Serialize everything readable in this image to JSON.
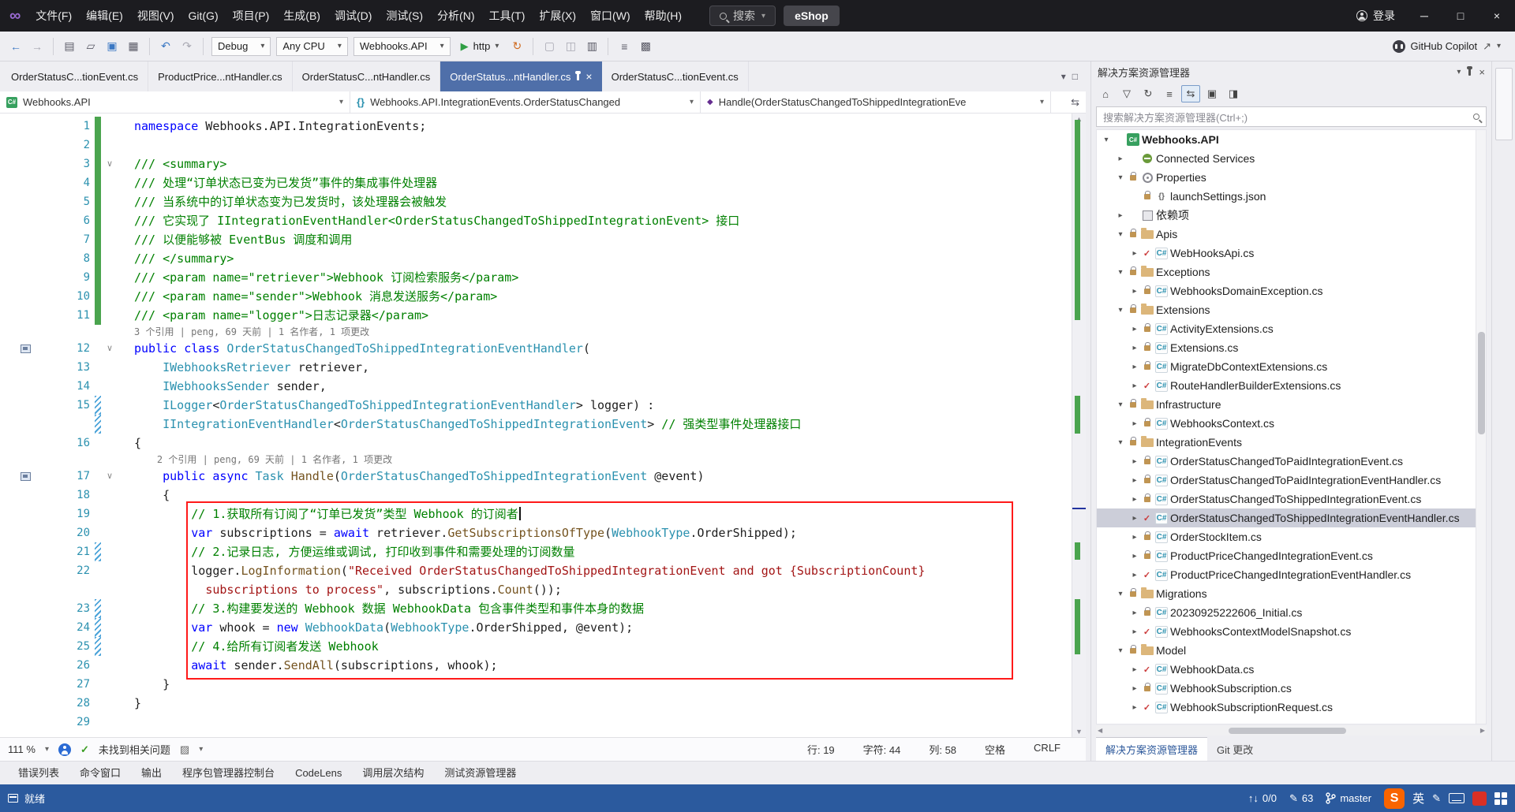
{
  "window": {
    "signin": "登录"
  },
  "menu": {
    "items": [
      "文件(F)",
      "编辑(E)",
      "视图(V)",
      "Git(G)",
      "项目(P)",
      "生成(B)",
      "调试(D)",
      "测试(S)",
      "分析(N)",
      "工具(T)",
      "扩展(X)",
      "窗口(W)",
      "帮助(H)"
    ],
    "search_label": "搜索",
    "project_pill": "eShop"
  },
  "toolbar": {
    "debug": "Debug",
    "platform": "Any CPU",
    "project": "Webhooks.API",
    "profile": "http",
    "copilot": "GitHub Copilot"
  },
  "tabs": [
    {
      "label": "OrderStatusC...tionEvent.cs",
      "active": false
    },
    {
      "label": "ProductPrice...ntHandler.cs",
      "active": false
    },
    {
      "label": "OrderStatusC...ntHandler.cs",
      "active": false
    },
    {
      "label": "OrderStatus...ntHandler.cs",
      "active": true
    },
    {
      "label": "OrderStatusC...tionEvent.cs",
      "active": false
    }
  ],
  "navbar": {
    "project": "Webhooks.API",
    "type": "Webhooks.API.IntegrationEvents.OrderStatusChanged",
    "member": "Handle(OrderStatusChangedToShippedIntegrationEve"
  },
  "editor": {
    "rows": [
      {
        "n": "1",
        "b": "g",
        "s": [
          [
            "namespace",
            "k"
          ],
          [
            " Webhooks.API.IntegrationEvents;",
            "p"
          ]
        ]
      },
      {
        "n": "2",
        "b": "g",
        "s": []
      },
      {
        "n": "3",
        "b": "g",
        "f": 1,
        "s": [
          [
            "/// <summary>",
            "c"
          ]
        ]
      },
      {
        "n": "4",
        "b": "g",
        "s": [
          [
            "/// 处理“订单状态已变为已发货”事件的集成事件处理器",
            "c"
          ]
        ]
      },
      {
        "n": "5",
        "b": "g",
        "s": [
          [
            "/// 当系统中的订单状态变为已发货时，该处理器会被触发",
            "c"
          ]
        ]
      },
      {
        "n": "6",
        "b": "g",
        "s": [
          [
            "/// 它实现了 IIntegrationEventHandler<OrderStatusChangedToShippedIntegrationEvent> 接口",
            "c"
          ]
        ]
      },
      {
        "n": "7",
        "b": "g",
        "s": [
          [
            "/// 以便能够被 EventBus 调度和调用",
            "c"
          ]
        ]
      },
      {
        "n": "8",
        "b": "g",
        "s": [
          [
            "/// </summary>",
            "c"
          ]
        ]
      },
      {
        "n": "9",
        "b": "g",
        "s": [
          [
            "/// <param name=\"retriever\">Webhook 订阅检索服务</param>",
            "c"
          ]
        ]
      },
      {
        "n": "10",
        "b": "g",
        "s": [
          [
            "/// <param name=\"sender\">Webhook 消息发送服务</param>",
            "c"
          ]
        ]
      },
      {
        "n": "11",
        "b": "g",
        "s": [
          [
            "/// <param name=\"logger\">日志记录器</param>",
            "c"
          ]
        ]
      },
      {
        "lens": 1,
        "s": [
          [
            "3 个引用 | peng, 69 天前 | 1 名作者, 1 项更改",
            "l"
          ]
        ]
      },
      {
        "n": "12",
        "f": 1,
        "r": 1,
        "s": [
          [
            "public",
            "k"
          ],
          [
            " ",
            "p"
          ],
          [
            "class",
            "k"
          ],
          [
            " ",
            "p"
          ],
          [
            "OrderStatusChangedToShippedIntegrationEventHandler",
            "t"
          ],
          [
            "(",
            "p"
          ]
        ]
      },
      {
        "n": "13",
        "s": [
          [
            "    ",
            "p"
          ],
          [
            "IWebhooksRetriever",
            "t"
          ],
          [
            " retriever,",
            "p"
          ]
        ]
      },
      {
        "n": "14",
        "s": [
          [
            "    ",
            "p"
          ],
          [
            "IWebhooksSender",
            "t"
          ],
          [
            " sender,",
            "p"
          ]
        ]
      },
      {
        "n": "15",
        "b": "h",
        "s": [
          [
            "    ",
            "p"
          ],
          [
            "ILogger",
            "t"
          ],
          [
            "<",
            "p"
          ],
          [
            "OrderStatusChangedToShippedIntegrationEventHandler",
            "t"
          ],
          [
            "> logger) :",
            "p"
          ]
        ]
      },
      {
        "b": "h",
        "s": [
          [
            "    ",
            "p"
          ],
          [
            "IIntegrationEventHandler",
            "t"
          ],
          [
            "<",
            "p"
          ],
          [
            "OrderStatusChangedToShippedIntegrationEvent",
            "t"
          ],
          [
            "> ",
            "p"
          ],
          [
            "// 强类型事件处理器接口",
            "c"
          ]
        ]
      },
      {
        "n": "16",
        "s": [
          [
            "{",
            "p"
          ]
        ]
      },
      {
        "lens": 1,
        "s": [
          [
            "    2 个引用 | peng, 69 天前 | 1 名作者, 1 项更改",
            "l"
          ]
        ]
      },
      {
        "n": "17",
        "f": 1,
        "r": 1,
        "s": [
          [
            "    ",
            "p"
          ],
          [
            "public",
            "k"
          ],
          [
            " ",
            "p"
          ],
          [
            "async",
            "k"
          ],
          [
            " ",
            "p"
          ],
          [
            "Task",
            "t"
          ],
          [
            " ",
            "p"
          ],
          [
            "Handle",
            "m"
          ],
          [
            "(",
            "p"
          ],
          [
            "OrderStatusChangedToShippedIntegrationEvent",
            "t"
          ],
          [
            " @event)",
            "p"
          ]
        ]
      },
      {
        "n": "18",
        "s": [
          [
            "    {",
            "p"
          ]
        ]
      },
      {
        "n": "19",
        "cur": 1,
        "s": [
          [
            "        ",
            "p"
          ],
          [
            "// 1.获取所有订阅了“订单已发货”类型 Webhook 的订阅者",
            "c"
          ]
        ]
      },
      {
        "n": "20",
        "s": [
          [
            "        ",
            "p"
          ],
          [
            "var",
            "k"
          ],
          [
            " subscriptions = ",
            "p"
          ],
          [
            "await",
            "k"
          ],
          [
            " retriever.",
            "p"
          ],
          [
            "GetSubscriptionsOfType",
            "m"
          ],
          [
            "(",
            "p"
          ],
          [
            "WebhookType",
            "t"
          ],
          [
            ".OrderShipped);",
            "p"
          ]
        ]
      },
      {
        "n": "21",
        "b": "h",
        "s": [
          [
            "        ",
            "p"
          ],
          [
            "// 2.记录日志, 方便运维或调试, 打印收到事件和需要处理的订阅数量",
            "c"
          ]
        ]
      },
      {
        "n": "22",
        "s": [
          [
            "        logger.",
            "p"
          ],
          [
            "LogInformation",
            "m"
          ],
          [
            "(",
            "p"
          ],
          [
            "\"Received OrderStatusChangedToShippedIntegrationEvent and got {SubscriptionCount}",
            "s"
          ]
        ]
      },
      {
        "s": [
          [
            "          ",
            "p"
          ],
          [
            "subscriptions to process\"",
            "s"
          ],
          [
            ", subscriptions.",
            "p"
          ],
          [
            "Count",
            "m"
          ],
          [
            "());",
            "p"
          ]
        ]
      },
      {
        "n": "23",
        "b": "h",
        "s": [
          [
            "        ",
            "p"
          ],
          [
            "// 3.构建要发送的 Webhook 数据 WebhookData 包含事件类型和事件本身的数据",
            "c"
          ]
        ]
      },
      {
        "n": "24",
        "b": "h",
        "s": [
          [
            "        ",
            "p"
          ],
          [
            "var",
            "k"
          ],
          [
            " whook = ",
            "p"
          ],
          [
            "new",
            "k"
          ],
          [
            " ",
            "p"
          ],
          [
            "WebhookData",
            "t"
          ],
          [
            "(",
            "p"
          ],
          [
            "WebhookType",
            "t"
          ],
          [
            ".OrderShipped, @event);",
            "p"
          ]
        ]
      },
      {
        "n": "25",
        "b": "h",
        "s": [
          [
            "        ",
            "p"
          ],
          [
            "// 4.给所有订阅者发送 Webhook",
            "c"
          ]
        ]
      },
      {
        "n": "26",
        "s": [
          [
            "        ",
            "p"
          ],
          [
            "await",
            "k"
          ],
          [
            " sender.",
            "p"
          ],
          [
            "SendAll",
            "m"
          ],
          [
            "(subscriptions, whook);",
            "p"
          ]
        ]
      },
      {
        "n": "27",
        "s": [
          [
            "    }",
            "p"
          ]
        ]
      },
      {
        "n": "28",
        "s": [
          [
            "}",
            "p"
          ]
        ]
      },
      {
        "n": "29",
        "s": []
      }
    ]
  },
  "solution_explorer": {
    "title": "解决方案资源管理器",
    "search_placeholder": "搜索解决方案资源管理器(Ctrl+;)",
    "bottom_tabs": [
      "解决方案资源管理器",
      "Git 更改"
    ],
    "items": [
      {
        "l": 0,
        "e": "e",
        "i": "project",
        "s": "",
        "t": "Webhooks.API",
        "root": 1
      },
      {
        "l": 1,
        "e": "c",
        "i": "plug",
        "s": "",
        "t": "Connected Services"
      },
      {
        "l": 1,
        "e": "e",
        "i": "wrench",
        "s": "lock",
        "t": "Properties"
      },
      {
        "l": 2,
        "e": "",
        "i": "json",
        "s": "lock",
        "t": "launchSettings.json"
      },
      {
        "l": 1,
        "e": "c",
        "i": "deps",
        "s": "",
        "t": "依赖项"
      },
      {
        "l": 1,
        "e": "e",
        "i": "folder",
        "s": "lock",
        "t": "Apis"
      },
      {
        "l": 2,
        "e": "c",
        "i": "csharp",
        "s": "check",
        "t": "WebHooksApi.cs"
      },
      {
        "l": 1,
        "e": "e",
        "i": "folder",
        "s": "lock",
        "t": "Exceptions"
      },
      {
        "l": 2,
        "e": "c",
        "i": "csharp",
        "s": "lock",
        "t": "WebhooksDomainException.cs"
      },
      {
        "l": 1,
        "e": "e",
        "i": "folder",
        "s": "lock",
        "t": "Extensions"
      },
      {
        "l": 2,
        "e": "c",
        "i": "csharp",
        "s": "lock",
        "t": "ActivityExtensions.cs"
      },
      {
        "l": 2,
        "e": "c",
        "i": "csharp",
        "s": "lock",
        "t": "Extensions.cs"
      },
      {
        "l": 2,
        "e": "c",
        "i": "csharp",
        "s": "lock",
        "t": "MigrateDbContextExtensions.cs"
      },
      {
        "l": 2,
        "e": "c",
        "i": "csharp",
        "s": "check",
        "t": "RouteHandlerBuilderExtensions.cs"
      },
      {
        "l": 1,
        "e": "e",
        "i": "folder",
        "s": "lock",
        "t": "Infrastructure"
      },
      {
        "l": 2,
        "e": "c",
        "i": "csharp",
        "s": "lock",
        "t": "WebhooksContext.cs"
      },
      {
        "l": 1,
        "e": "e",
        "i": "folder",
        "s": "lock",
        "t": "IntegrationEvents"
      },
      {
        "l": 2,
        "e": "c",
        "i": "csharp",
        "s": "lock",
        "t": "OrderStatusChangedToPaidIntegrationEvent.cs"
      },
      {
        "l": 2,
        "e": "c",
        "i": "csharp",
        "s": "lock",
        "t": "OrderStatusChangedToPaidIntegrationEventHandler.cs"
      },
      {
        "l": 2,
        "e": "c",
        "i": "csharp",
        "s": "lock",
        "t": "OrderStatusChangedToShippedIntegrationEvent.cs"
      },
      {
        "l": 2,
        "e": "c",
        "i": "csharp",
        "s": "check",
        "t": "OrderStatusChangedToShippedIntegrationEventHandler.cs",
        "sel": 1
      },
      {
        "l": 2,
        "e": "c",
        "i": "csharp",
        "s": "lock",
        "t": "OrderStockItem.cs"
      },
      {
        "l": 2,
        "e": "c",
        "i": "csharp",
        "s": "lock",
        "t": "ProductPriceChangedIntegrationEvent.cs"
      },
      {
        "l": 2,
        "e": "c",
        "i": "csharp",
        "s": "check",
        "t": "ProductPriceChangedIntegrationEventHandler.cs"
      },
      {
        "l": 1,
        "e": "e",
        "i": "folder",
        "s": "lock",
        "t": "Migrations"
      },
      {
        "l": 2,
        "e": "c",
        "i": "csharp",
        "s": "lock",
        "t": "20230925222606_Initial.cs"
      },
      {
        "l": 2,
        "e": "c",
        "i": "csharp",
        "s": "check",
        "t": "WebhooksContextModelSnapshot.cs"
      },
      {
        "l": 1,
        "e": "e",
        "i": "folder",
        "s": "lock",
        "t": "Model"
      },
      {
        "l": 2,
        "e": "c",
        "i": "csharp",
        "s": "check",
        "t": "WebhookData.cs"
      },
      {
        "l": 2,
        "e": "c",
        "i": "csharp",
        "s": "lock",
        "t": "WebhookSubscription.cs"
      },
      {
        "l": 2,
        "e": "c",
        "i": "csharp",
        "s": "check",
        "t": "WebhookSubscriptionRequest.cs"
      }
    ]
  },
  "editor_statusbar": {
    "zoom": "111 %",
    "health": "未找到相关问题",
    "line": "行: 19",
    "ch": "字符: 44",
    "col": "列: 58",
    "ws": "空格",
    "eol": "CRLF"
  },
  "panel_tabs": [
    "错误列表",
    "命令窗口",
    "输出",
    "程序包管理器控制台",
    "CodeLens",
    "调用层次结构",
    "测试资源管理器"
  ],
  "statusbar": {
    "ready": "就绪",
    "sync": "0/0",
    "edits": "63",
    "branch": "master",
    "sogou": "S",
    "ime": "英"
  },
  "icons": {
    "vs_logo": "∞",
    "chevron_down": "▾",
    "close": "×",
    "min": "─",
    "max": "□",
    "back": "←",
    "forward": "→",
    "new_file": "▤",
    "open": "▱",
    "save": "▣",
    "save_all": "▦",
    "undo": "↶",
    "redo": "↷",
    "play": "▶",
    "hot_reload": "↻",
    "generic1": "▢",
    "generic2": "◫",
    "generic3": "▥",
    "generic4": "≡",
    "generic5": "▩",
    "external": "↗",
    "check": "✓",
    "cleanup": "▨",
    "se_home": "⌂",
    "se_filter": "▽",
    "se_sync": "⇆",
    "se_refresh": "↻",
    "se_collapse": "≡",
    "se_props": "▣",
    "se_preview": "◨",
    "fold_open": "∨",
    "expander_collapsed": "▸",
    "expander_expanded": "▾",
    "scroll_up": "▲",
    "scroll_down": "▼",
    "scroll_left": "◀",
    "scroll_right": "▶",
    "updown": "↑↓",
    "pencil": "✎",
    "nav_swap": "⇆"
  }
}
